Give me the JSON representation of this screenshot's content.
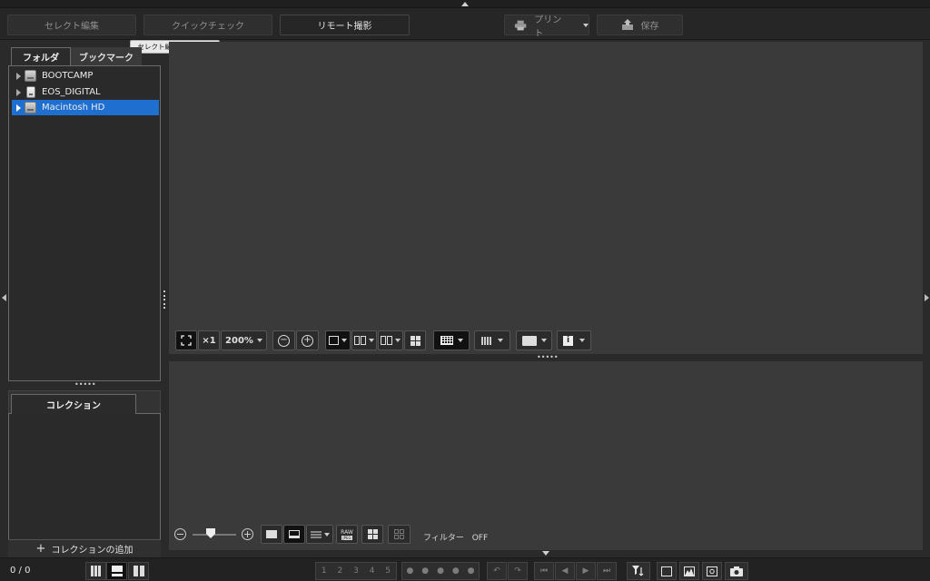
{
  "top_tabs": [
    {
      "label": "セレクト編集"
    },
    {
      "label": "クイックチェック"
    },
    {
      "label": "リモート撮影"
    }
  ],
  "actions": {
    "print_label": "プリント",
    "save_label": "保存"
  },
  "tooltip": {
    "text": "セレクト編集画面 (⌘→)"
  },
  "left_panel": {
    "tabs": [
      {
        "label": "フォルダ"
      },
      {
        "label": "ブックマーク"
      }
    ],
    "folders": [
      {
        "label": "BOOTCAMP"
      },
      {
        "label": "EOS_DIGITAL"
      },
      {
        "label": "Macintosh HD"
      }
    ],
    "collection_tab": "コレクション",
    "add_collection": "コレクションの追加"
  },
  "viewer_toolbar": {
    "actual_size": "×1",
    "zoom": "200%",
    "zoom_out": "−",
    "zoom_in": "+"
  },
  "thumb_toolbar": {
    "raw_top": "RAW",
    "raw_bottom": "JPEG",
    "filter_label": "フィルター",
    "filter_value": "OFF"
  },
  "statusbar": {
    "count": "0 / 0",
    "ratings": [
      "1",
      "2",
      "3",
      "4",
      "5"
    ]
  }
}
